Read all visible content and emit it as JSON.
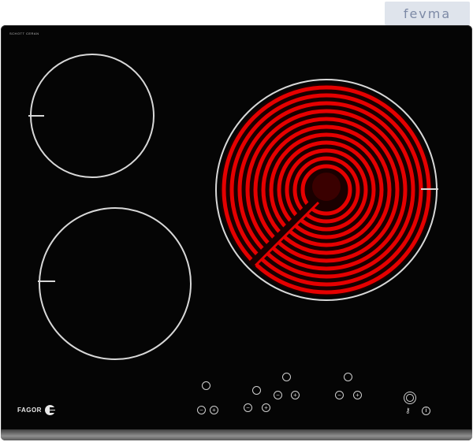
{
  "watermark": {
    "text": "fevma"
  },
  "hob": {
    "brand": "FAGOR",
    "glass_label": "SCHOTT CERAN",
    "zones": [
      {
        "state": "off"
      },
      {
        "state": "off"
      },
      {
        "state": "on",
        "glow_color": "#e50000"
      }
    ],
    "controls": {
      "timer_icon": "clock-icon",
      "minus_symbol": "−",
      "plus_symbol": "+",
      "power_icon": "power-icon",
      "lock_icon": "key-lock-icon",
      "info_symbol": "i"
    }
  },
  "colors": {
    "glass": "#050505",
    "zone_outline": "#d8d8d8",
    "element_red": "#e50000",
    "frame": "#8f8f8f"
  }
}
